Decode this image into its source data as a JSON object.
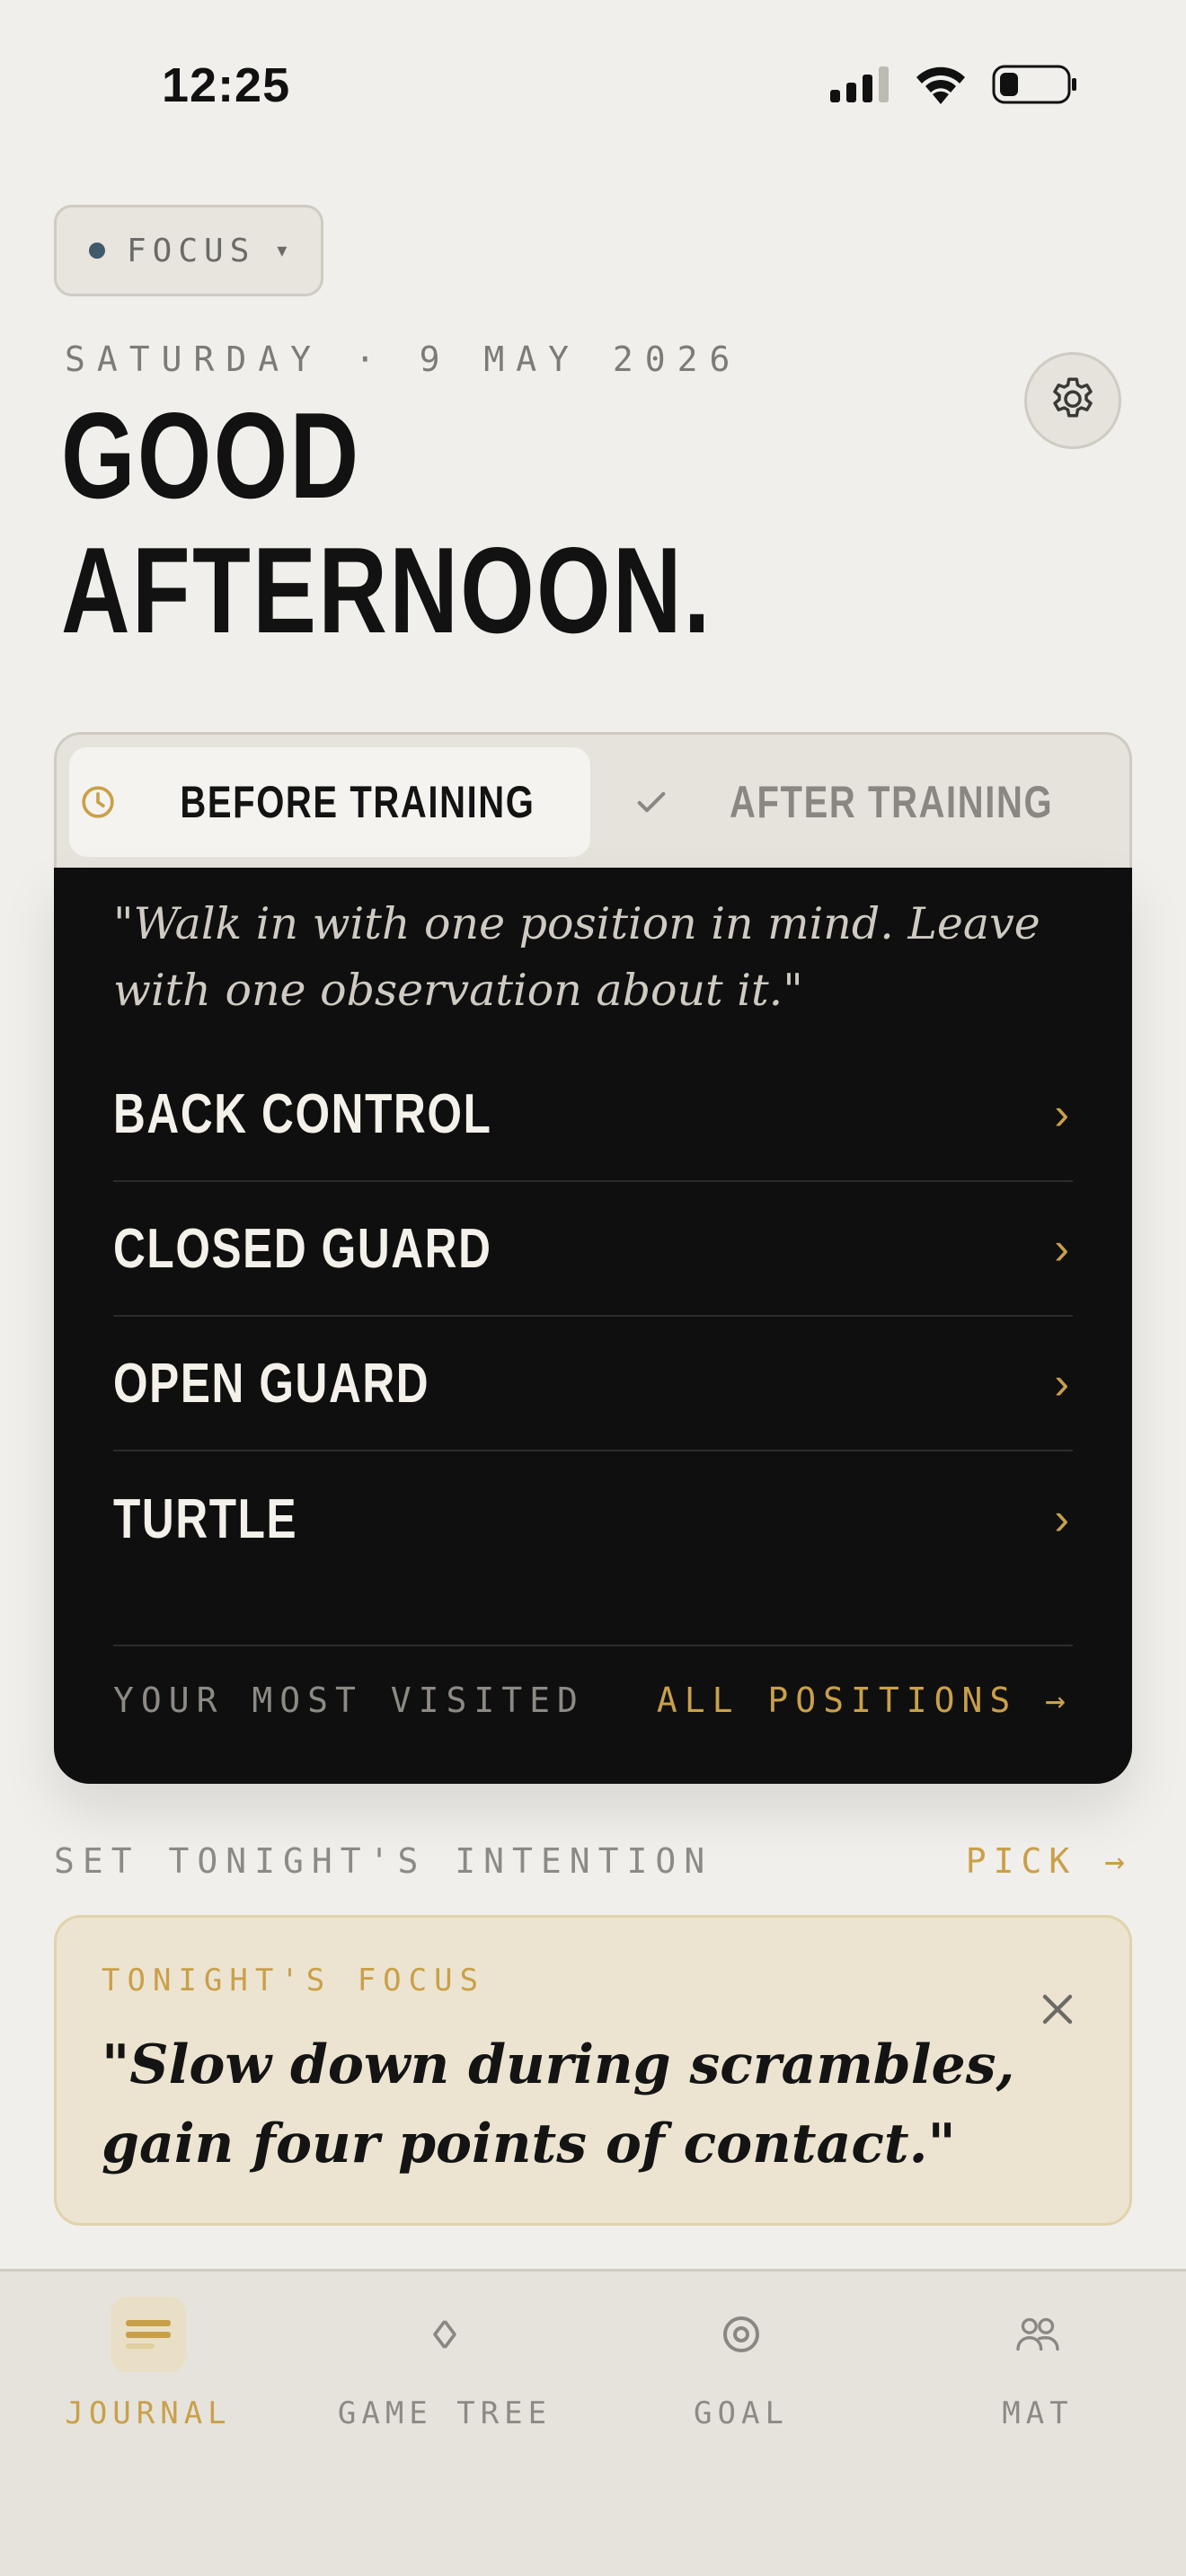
{
  "status_bar": {
    "time": "12:25"
  },
  "focus_selector": {
    "label": "FOCUS",
    "caret": "▾"
  },
  "header": {
    "date": "SATURDAY · 9 MAY 2026",
    "greeting_line1": "GOOD",
    "greeting_line2": "AFTERNOON."
  },
  "segment": {
    "before_label": "BEFORE TRAINING",
    "after_label": "AFTER TRAINING",
    "selected": "BEFORE TRAINING"
  },
  "card": {
    "quote": "\"Walk in with one position in mind. Leave with one observation about it.\"",
    "positions": [
      {
        "label": "BACK CONTROL"
      },
      {
        "label": "CLOSED GUARD"
      },
      {
        "label": "OPEN GUARD"
      },
      {
        "label": "TURTLE"
      }
    ],
    "chevron": "›",
    "footer_left": "YOUR MOST VISITED",
    "footer_right": "ALL POSITIONS →"
  },
  "intention": {
    "title": "SET TONIGHT'S INTENTION",
    "pick_label": "PICK →",
    "focus_label": "TONIGHT'S FOCUS",
    "focus_quote": "\"Slow down during scrambles, gain four points of contact.\""
  },
  "nav": {
    "items": [
      {
        "label": "JOURNAL",
        "icon": "journal-icon",
        "active": true
      },
      {
        "label": "GAME TREE",
        "icon": "diamond-icon",
        "active": false
      },
      {
        "label": "GOAL",
        "icon": "target-icon",
        "active": false
      },
      {
        "label": "MAT",
        "icon": "people-icon",
        "active": false
      }
    ]
  },
  "colors": {
    "background": "#f1efeb",
    "card_dark": "#0f0f0f",
    "accent_gold": "#c9a04a",
    "focus_card_bg": "#ece4d0",
    "focus_dot": "#3f5a6b"
  }
}
